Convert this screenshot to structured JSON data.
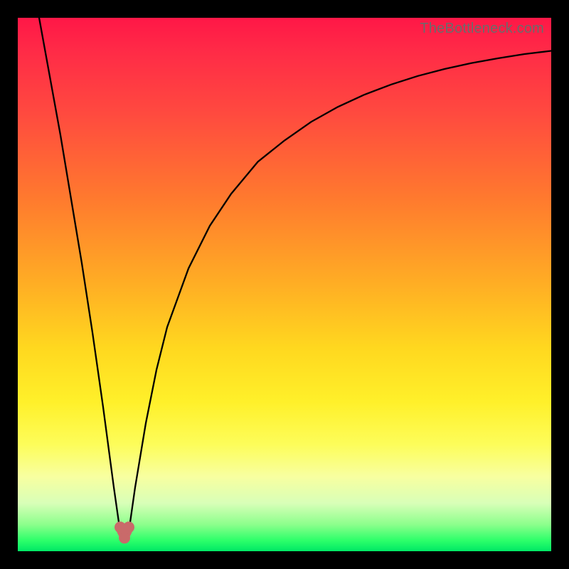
{
  "watermark": "TheBottleneck.com",
  "chart_data": {
    "type": "line",
    "title": "",
    "xlabel": "",
    "ylabel": "",
    "xlim": [
      0,
      100
    ],
    "ylim": [
      0,
      100
    ],
    "grid": false,
    "legend": false,
    "series": [
      {
        "name": "bottleneck-curve",
        "x": [
          4,
          6,
          8,
          10,
          12,
          14,
          16,
          18,
          19,
          20,
          21,
          22,
          24,
          26,
          28,
          32,
          36,
          40,
          45,
          50,
          55,
          60,
          65,
          70,
          75,
          80,
          85,
          90,
          95,
          100
        ],
        "y": [
          100,
          89,
          78,
          66,
          54,
          41,
          27,
          12,
          5,
          2,
          5,
          12,
          24,
          34,
          42,
          53,
          61,
          67,
          73,
          77,
          80.5,
          83.3,
          85.6,
          87.5,
          89.1,
          90.4,
          91.5,
          92.4,
          93.2,
          93.8
        ]
      }
    ],
    "markers": [
      {
        "name": "cusp-left",
        "x": 19.2,
        "y": 4.5
      },
      {
        "name": "cusp-right",
        "x": 20.8,
        "y": 4.5
      },
      {
        "name": "cusp-bottom",
        "x": 20.0,
        "y": 2.5
      }
    ],
    "marker_color": "#c96a6a",
    "curve_color": "#000000"
  }
}
